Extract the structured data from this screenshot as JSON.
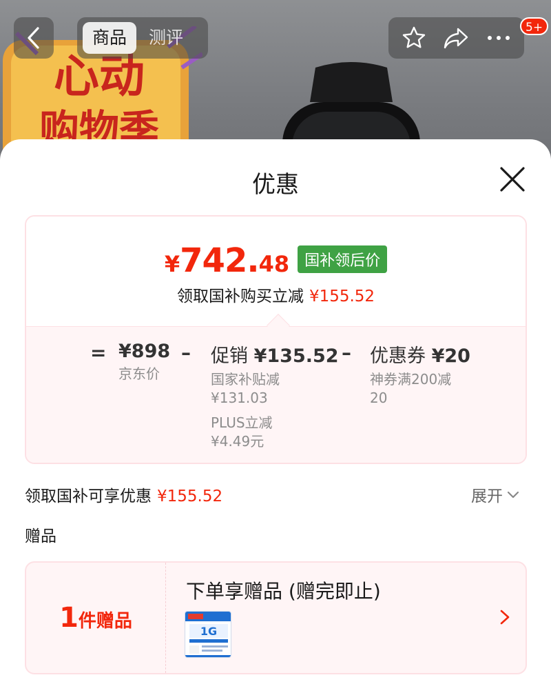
{
  "background": {
    "promo_line1": "心动",
    "promo_line2": "购物季"
  },
  "nav": {
    "tabs": [
      "商品",
      "测评"
    ],
    "badge": "5+"
  },
  "sheet": {
    "title": "优惠",
    "price": {
      "yen": "¥",
      "integer": "742.",
      "decimal": "48",
      "tag": "国补领后价"
    },
    "claim_line": {
      "text": "领取国补购买立减",
      "amount": "¥155.52"
    },
    "formula": {
      "eq": "=",
      "minus": "–",
      "base": {
        "value": "¥898",
        "label": "京东价"
      },
      "promo": {
        "title": "促销",
        "value": "¥135.52",
        "details": [
          "国家补贴减",
          "¥131.03",
          "PLUS立减",
          "¥4.49元"
        ]
      },
      "coupon": {
        "title": "优惠券",
        "value": "¥20",
        "details": [
          "神券满200减",
          "20"
        ]
      }
    },
    "discount_row": {
      "text": "领取国补可享优惠",
      "amount": "¥155.52",
      "expand": "展开"
    },
    "gift_label": "赠品",
    "gift": {
      "count": "1",
      "count_suffix": "件赠品",
      "title": "下单享赠品 (赠完即止)",
      "thumb_text": "1G"
    }
  },
  "colors": {
    "accent_red": "#f2270c",
    "tag_green": "#3fa244",
    "card_border": "#fde0e4",
    "card_bg": "#fff5f6"
  }
}
